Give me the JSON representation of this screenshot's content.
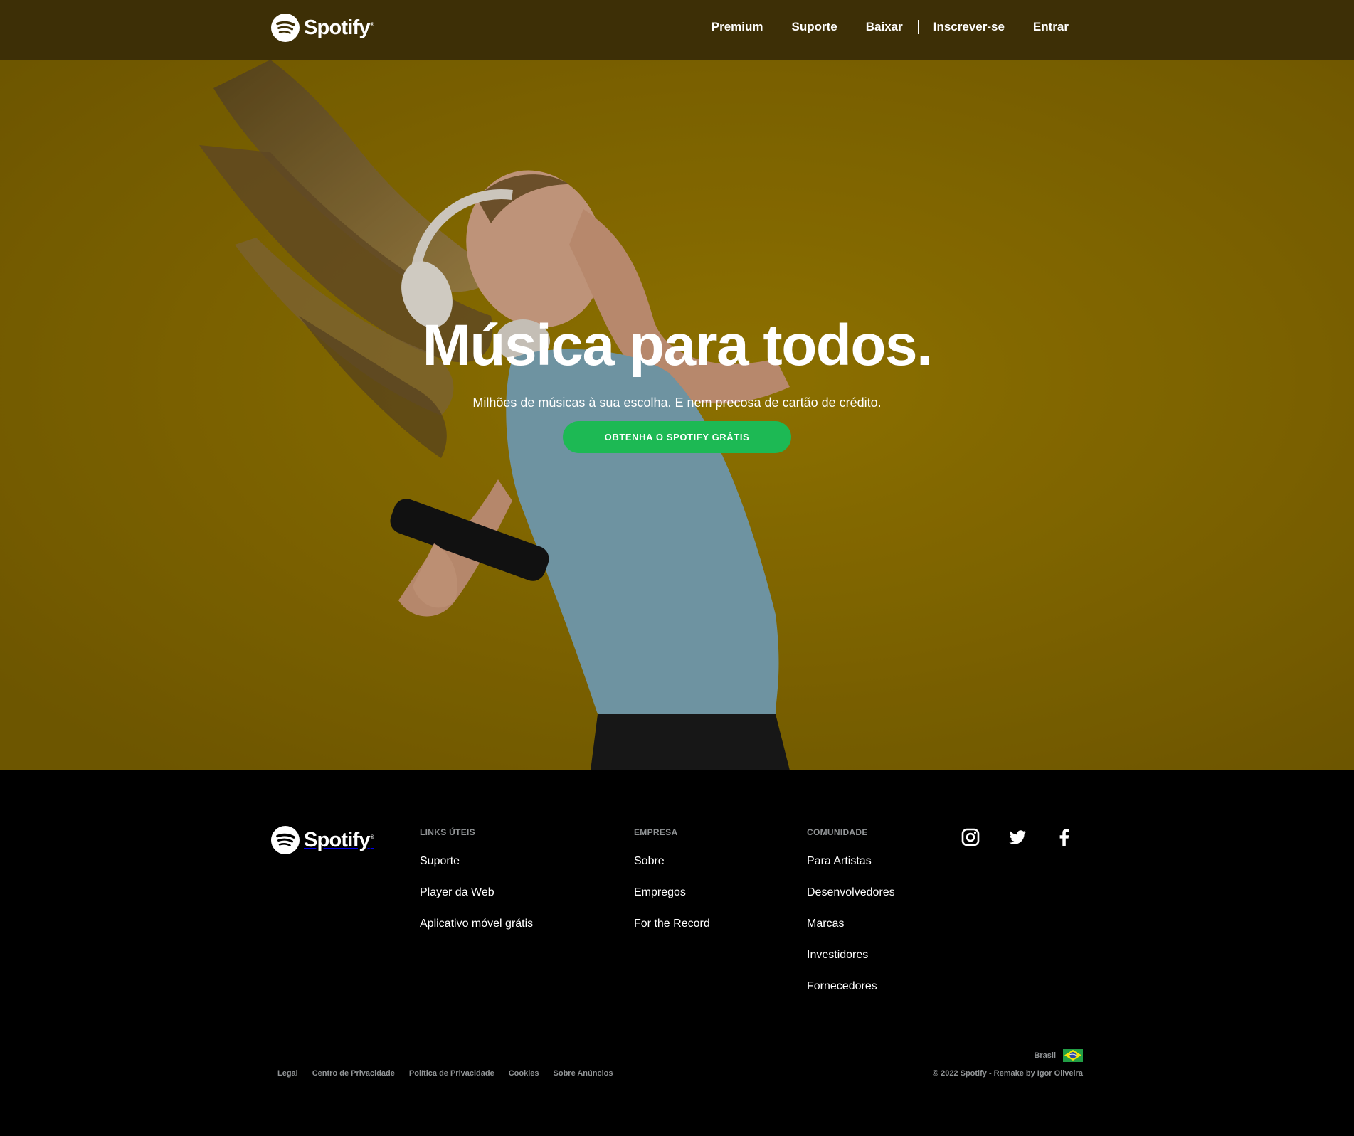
{
  "brand": {
    "name": "Spotify",
    "trademark": "®",
    "accent_color": "#1db954",
    "nav_bg": "#3d2f06",
    "hero_bg": "#8e7100"
  },
  "nav": {
    "links": [
      "Premium",
      "Suporte",
      "Baixar",
      "Inscrever-se",
      "Entrar"
    ]
  },
  "hero": {
    "title": "Música para todos.",
    "subtitle": "Milhões de músicas à sua escolha. E nem precosa de cartão de crédito.",
    "cta": "OBTENHA O SPOTIFY GRÁTIS"
  },
  "footer": {
    "columns": [
      {
        "heading": "LINKS ÚTEIS",
        "links": [
          "Suporte",
          "Player da Web",
          "Aplicativo móvel grátis"
        ]
      },
      {
        "heading": "EMPRESA",
        "links": [
          "Sobre",
          "Empregos",
          "For the Record"
        ]
      },
      {
        "heading": "COMUNIDADE",
        "links": [
          "Para Artistas",
          "Desenvolvedores",
          "Marcas",
          "Investidores",
          "Fornecedores"
        ]
      }
    ],
    "social_icons": [
      "instagram-icon",
      "twitter-icon",
      "facebook-icon"
    ],
    "region": "Brasil",
    "region_flag": "brazil-flag-icon",
    "legal_links": [
      "Legal",
      "Centro de Privacidade",
      "Política de Privacidade",
      "Cookies",
      "Sobre Anúncios"
    ],
    "copyright": "© 2022 Spotify - Remake by Igor Oliveira"
  }
}
